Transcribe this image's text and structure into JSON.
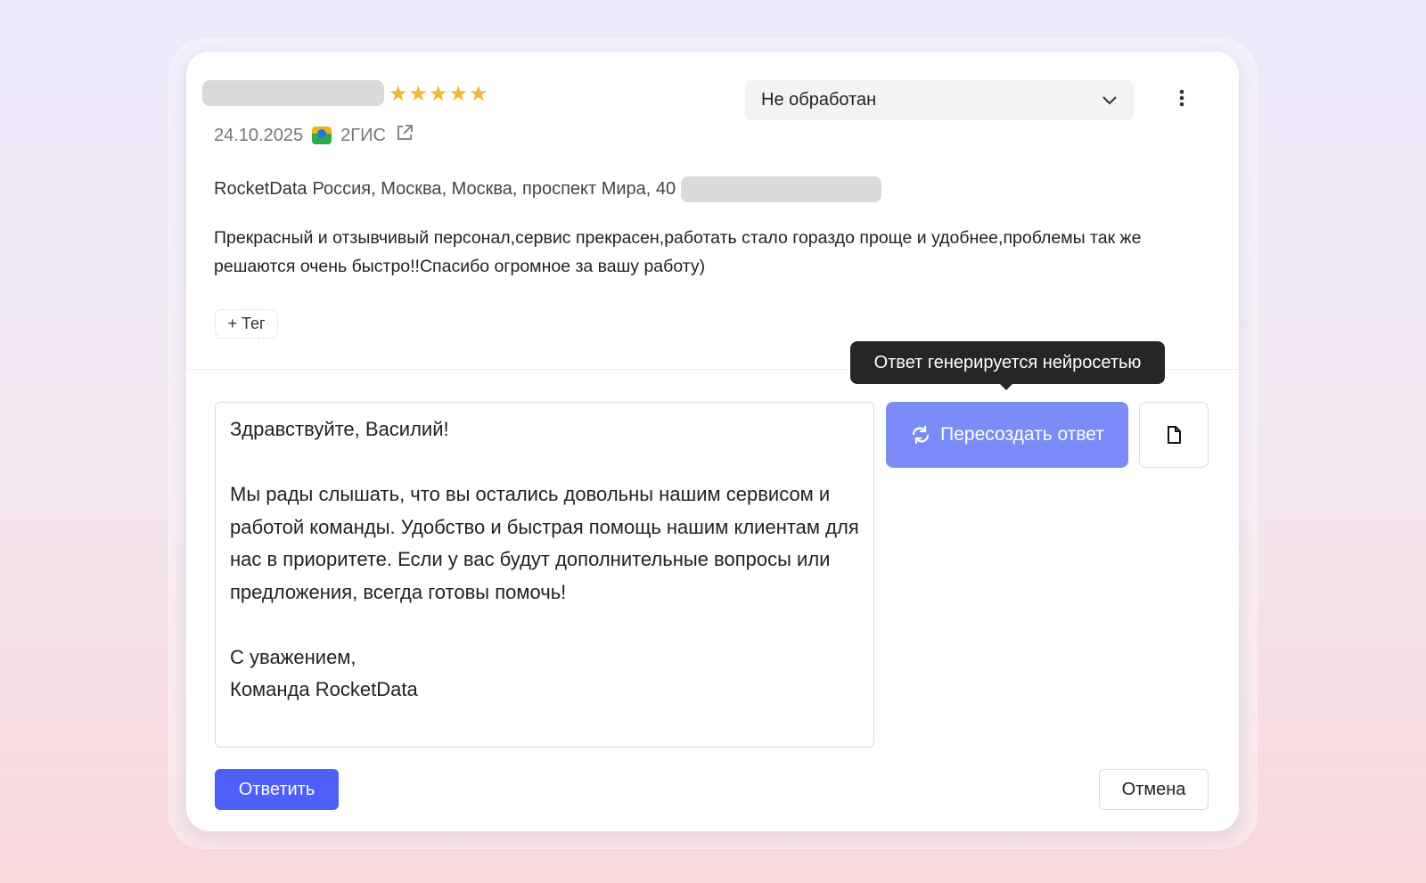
{
  "review": {
    "rating": 5,
    "stars": "★★★★★",
    "date": "24.10.2025",
    "source": "2ГИС",
    "company": "RocketData",
    "address": "Россия, Москва, Москва, проспект Мира, 40",
    "text": "Прекрасный и отзывчивый персонал,сервис прекрасен,работать стало гораздо проще и удобнее,проблемы так же решаются очень быстро!!Спасибо огромное за вашу работу)",
    "add_tag_label": "+ Тег"
  },
  "status_select": {
    "value": "Не обработан"
  },
  "reply": {
    "text": "Здравствуйте, Василий!\n\nМы рады слышать, что вы остались довольны нашим сервисом и работой команды. Удобство и быстрая помощь нашим клиентам для нас в приоритете. Если у вас будут дополнительные вопросы или предложения, всегда готовы помочь!\n\nС уважением,\nКоманда RocketData",
    "tooltip": "Ответ генерируется нейросетью",
    "regenerate_label": "Пересоздать ответ",
    "submit_label": "Ответить",
    "cancel_label": "Отмена"
  }
}
